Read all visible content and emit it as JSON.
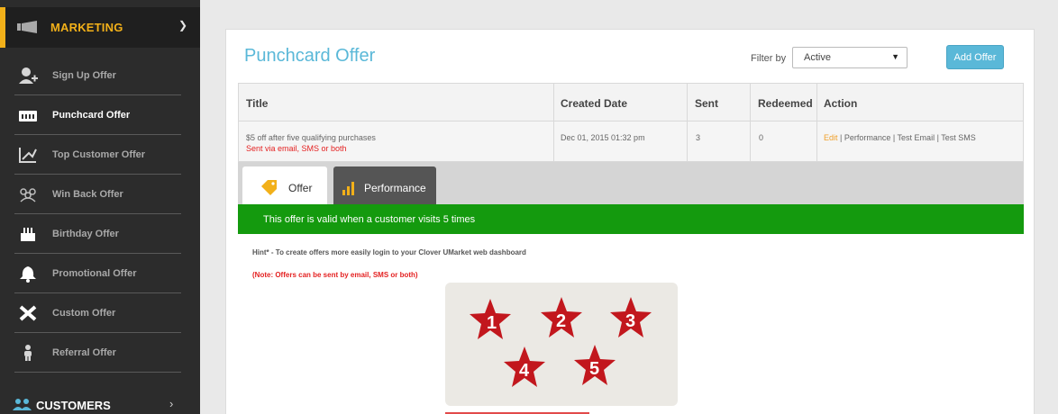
{
  "sidebar": {
    "section_marketing": "MARKETING",
    "items": [
      {
        "label": "Sign Up Offer",
        "icon": "user-add-icon",
        "active": false
      },
      {
        "label": "Punchcard Offer",
        "icon": "punchcard-icon",
        "active": true
      },
      {
        "label": "Top Customer Offer",
        "icon": "chart-icon",
        "active": false
      },
      {
        "label": "Win Back Offer",
        "icon": "group-icon",
        "active": false
      },
      {
        "label": "Birthday Offer",
        "icon": "cake-icon",
        "active": false
      },
      {
        "label": "Promotional Offer",
        "icon": "bell-icon",
        "active": false
      },
      {
        "label": "Custom Offer",
        "icon": "tools-icon",
        "active": false
      },
      {
        "label": "Referral Offer",
        "icon": "person-icon",
        "active": false
      }
    ],
    "section_customers": "CUSTOMERS"
  },
  "panel": {
    "title": "Punchcard Offer",
    "filter_label": "Filter by",
    "filter_value": "Active",
    "add_button": "Add Offer"
  },
  "table": {
    "headers": [
      "Title",
      "Created Date",
      "Sent",
      "Redeemed",
      "Action"
    ],
    "row": {
      "title": "$5 off after five qualifying purchases",
      "subtitle": "Sent via email, SMS or both",
      "created": "Dec 01, 2015 01:32 pm",
      "sent": "3",
      "redeemed": "0",
      "action_edit": "Edit",
      "action_rest": " | Performance | Test Email | Test SMS"
    }
  },
  "tabs": {
    "offer": "Offer",
    "performance": "Performance"
  },
  "offer_detail": {
    "valid_text": "This offer is valid when a customer visits 5 times",
    "hint": "Hint* - To create offers more easily login to your Clover UMarket web dashboard",
    "note": "(Note: Offers can be sent by email, SMS or both)",
    "stars": [
      "1",
      "2",
      "3",
      "4",
      "5"
    ]
  },
  "colors": {
    "accent": "#5ab8d8",
    "marketing": "#f2b019",
    "valid_bar": "#149a0e",
    "note_red": "#e42222",
    "star_red": "#c2171d"
  }
}
